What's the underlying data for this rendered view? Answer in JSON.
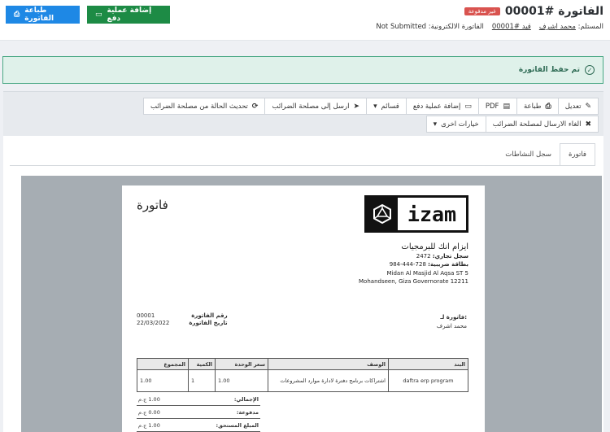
{
  "header": {
    "title": "الفاتورة #00001",
    "status_badge": "غير مدفوعة",
    "recipient_label": "المستلم:",
    "recipient_name": "محمد اشرف",
    "entry_link": "قيد #00001",
    "einvoice_label": "الفاتورة الالكترونية:",
    "einvoice_status": "Not Submitted",
    "print_button": "طباعة الفاتورة",
    "add_payment_button": "إضافة عملية دفع"
  },
  "alert": {
    "message": "تم حفظ الفاتورة"
  },
  "toolbar": {
    "row1": [
      {
        "label": "تعديل",
        "icon": "✎",
        "name": "edit"
      },
      {
        "label": "طباعة",
        "icon": "⎙",
        "name": "print"
      },
      {
        "label": "PDF",
        "icon": "▤",
        "name": "pdf"
      },
      {
        "label": "إضافة عملية دفع",
        "icon": "▭",
        "name": "add-payment"
      },
      {
        "label": "قسائم",
        "icon": "▾",
        "name": "vouchers"
      },
      {
        "label": "ارسل إلى مصلحة الضرائب",
        "icon": "➤",
        "name": "send-tax"
      },
      {
        "label": "تحديث الحالة من مصلحة الضرائب",
        "icon": "⟳",
        "name": "refresh-status"
      }
    ],
    "row2": [
      {
        "label": "الغاء الارسال لمصلحة الضرائب",
        "icon": "✖",
        "name": "cancel-send"
      },
      {
        "label": "خيارات اخرى",
        "icon": "▾",
        "name": "more-options"
      }
    ]
  },
  "tabs": [
    "فاتورة",
    "سجل النشاطات"
  ],
  "invoice": {
    "doc_title": "فاتورة",
    "logo_text": "izam",
    "company_name": "ايزام انك للبرمجيات",
    "cr_label": "سجل تجاري:",
    "cr_value": "2472",
    "tax_label": "بطاقة ضريبية:",
    "tax_value": "984-444-728",
    "address1": "Midan Al Masjid Al Aqsa ST 5",
    "address2": "Mohandseen, Giza Governorate 12211",
    "bill_to_label": "فاتورة لـ:",
    "bill_to_name": "محمد اشرف",
    "number_label": "رقم الفاتورة",
    "number_value": "00001",
    "date_label": "تاريخ الفاتورة",
    "date_value": "22/03/2022",
    "columns": [
      "البند",
      "الوصف",
      "سعر الوحدة",
      "الكمية",
      "المجموع"
    ],
    "rows": [
      [
        "daftra erp program",
        "اشتراكات برنامج دفترة لادارة موارد المشروعات",
        "1.00",
        "1",
        "1.00"
      ]
    ],
    "totals": [
      {
        "label": "الإجمالي:",
        "value": "1.00 ج.م"
      },
      {
        "label": "مدفوعة:",
        "value": "0.00 ج.م"
      },
      {
        "label": "المبلغ المستحق:",
        "value": "1.00 ج.م"
      }
    ]
  }
}
